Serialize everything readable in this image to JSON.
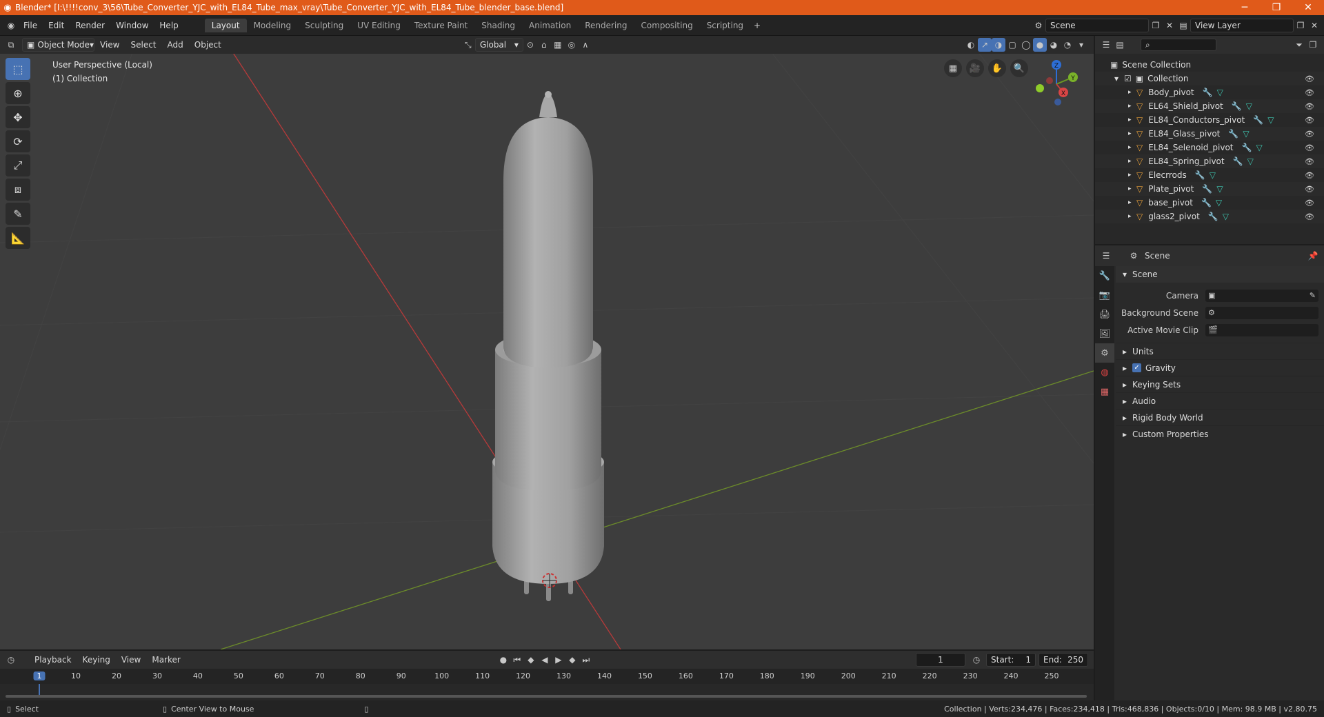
{
  "titlebar": {
    "title": "Blender* [I:\\!!!!conv_3\\56\\Tube_Converter_YJC_with_EL84_Tube_max_vray\\Tube_Converter_YJC_with_EL84_Tube_blender_base.blend]",
    "minimize": "─",
    "maximize": "❐",
    "close": "✕"
  },
  "menubar": {
    "items": [
      "File",
      "Edit",
      "Render",
      "Window",
      "Help"
    ]
  },
  "workspaces": [
    "Layout",
    "Modeling",
    "Sculpting",
    "UV Editing",
    "Texture Paint",
    "Shading",
    "Animation",
    "Rendering",
    "Compositing",
    "Scripting"
  ],
  "scene_selector": {
    "value": "Scene"
  },
  "view_layer": {
    "value": "View Layer"
  },
  "viewport_header": {
    "mode": "Object Mode",
    "menus": [
      "View",
      "Select",
      "Add",
      "Object"
    ],
    "orientation": "Global"
  },
  "viewport": {
    "perspective_label": "User Perspective (Local)",
    "collection_label": "(1) Collection",
    "axis_labels": {
      "z": "Z",
      "y": "Y",
      "x": "X"
    }
  },
  "outliner": {
    "search_placeholder": "",
    "scene_collection": "Scene Collection",
    "collection": "Collection",
    "objects": [
      "Body_pivot",
      "EL64_Shield_pivot",
      "EL84_Conductors_pivot",
      "EL84_Glass_pivot",
      "EL84_Selenoid_pivot",
      "EL84_Spring_pivot",
      "Elecrrods",
      "Plate_pivot",
      "base_pivot",
      "glass2_pivot"
    ]
  },
  "properties": {
    "context": "Scene",
    "panel_title": "Scene",
    "rows": [
      {
        "label": "Camera",
        "value": ""
      },
      {
        "label": "Background Scene",
        "value": ""
      },
      {
        "label": "Active Movie Clip",
        "value": ""
      }
    ],
    "subpanels": [
      "Units",
      "Gravity",
      "Keying Sets",
      "Audio",
      "Rigid Body World",
      "Custom Properties"
    ]
  },
  "timeline": {
    "menus": [
      "Playback",
      "Keying",
      "View",
      "Marker"
    ],
    "current_frame": "1",
    "start_label": "Start:",
    "start": "1",
    "end_label": "End:",
    "end": "250",
    "ticks": [
      "1",
      "10",
      "20",
      "30",
      "40",
      "50",
      "60",
      "70",
      "80",
      "90",
      "100",
      "110",
      "120",
      "130",
      "140",
      "150",
      "160",
      "170",
      "180",
      "190",
      "200",
      "210",
      "220",
      "230",
      "240",
      "250"
    ]
  },
  "statusbar": {
    "left1": "Select",
    "left2": "Center View to Mouse",
    "right": "Collection | Verts:234,476 | Faces:234,418 | Tris:468,836 | Objects:0/10 | Mem: 98.9 MB | v2.80.75"
  },
  "colors": {
    "titlebar": "#e05a1a",
    "accent": "#4772b3",
    "x_axis": "#b83a3a",
    "y_axis": "#6c8c2a",
    "object_icon": "#e8a03a",
    "mesh_icon": "#3ec5b0",
    "modifier_icon": "#6a9ae8"
  }
}
